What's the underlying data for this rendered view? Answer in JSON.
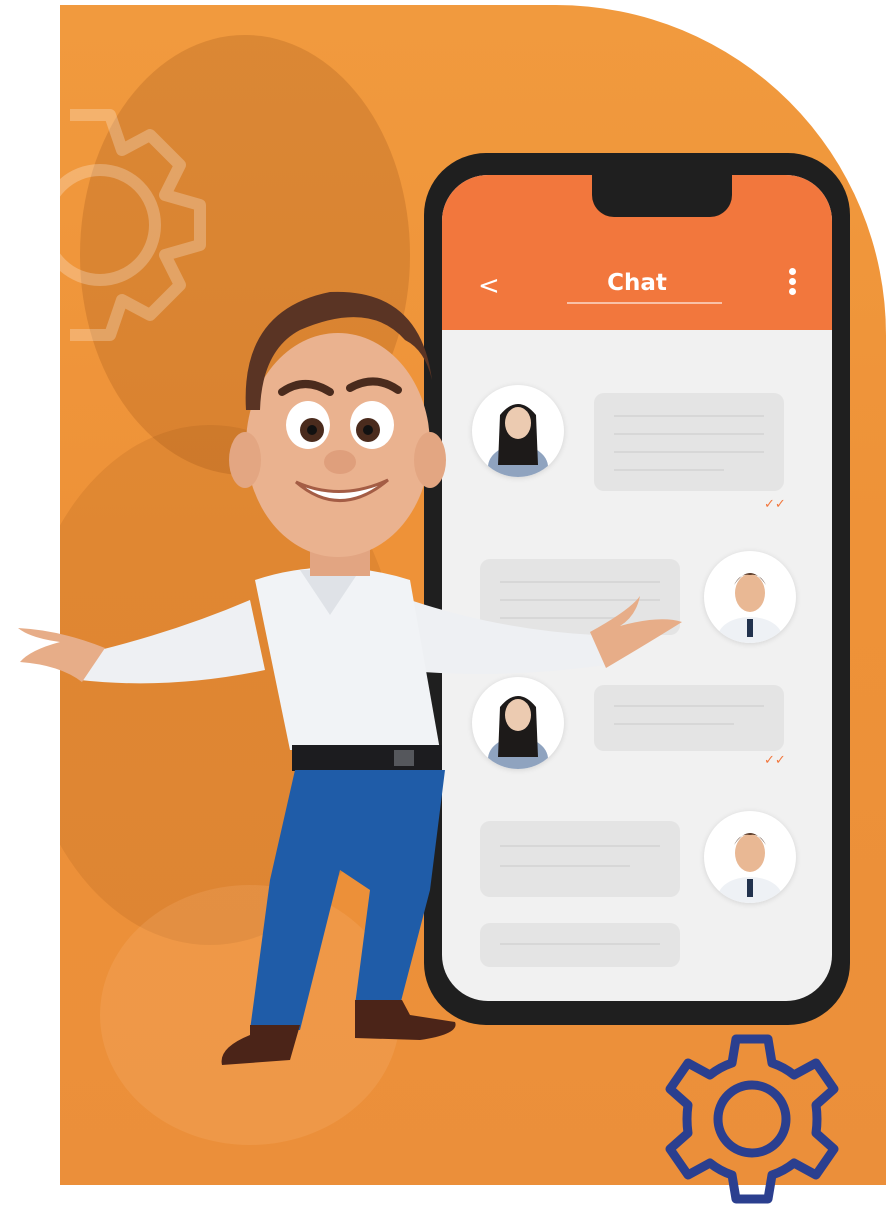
{
  "chat": {
    "title": "Chat",
    "back_icon": "<",
    "more_icon": "vertical-ellipsis-icon"
  },
  "colors": {
    "accent": "#f2773d",
    "background_orange": "#ee9238",
    "gear_outline": "#2b3f8f",
    "bubble": "#e4e4e4"
  },
  "messages": [
    {
      "side": "left",
      "avatar": "woman-avatar",
      "read_mark": "✓✓"
    },
    {
      "side": "right",
      "avatar": "man-avatar"
    },
    {
      "side": "left",
      "avatar": "woman-avatar",
      "read_mark": "✓✓"
    },
    {
      "side": "right",
      "avatar": "man-avatar"
    },
    {
      "side": "right",
      "avatar": "none"
    }
  ]
}
